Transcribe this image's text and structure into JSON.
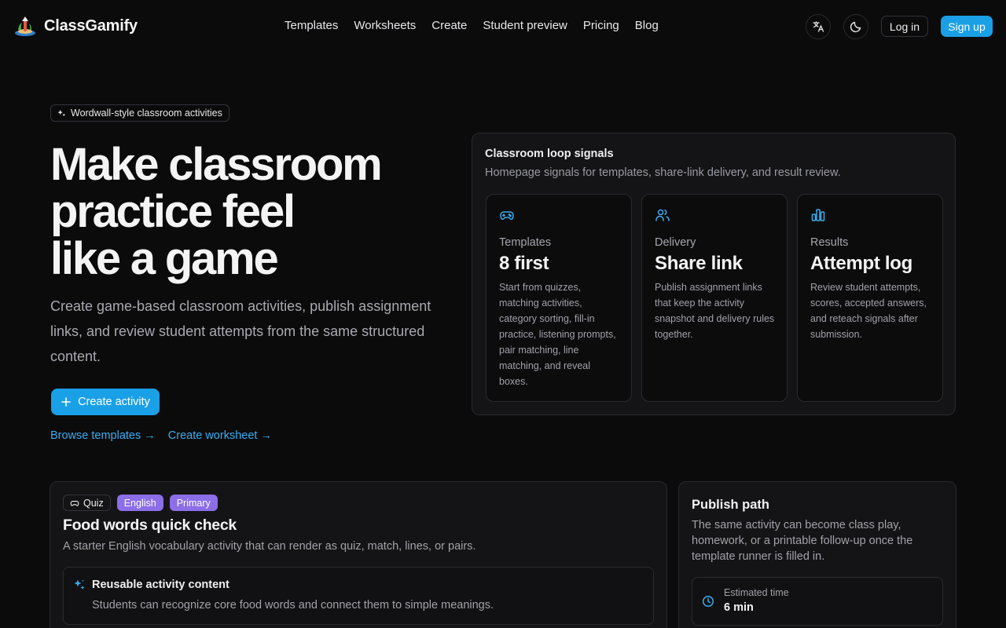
{
  "header": {
    "brand": "ClassGamify",
    "nav": [
      "Templates",
      "Worksheets",
      "Create",
      "Student preview",
      "Pricing",
      "Blog"
    ],
    "login": "Log in",
    "signup": "Sign up"
  },
  "hero": {
    "badge": "Wordwall-style classroom activities",
    "title_lines": [
      "Make classroom",
      "practice feel",
      "like a game"
    ],
    "subtitle": "Create game-based classroom activities, publish assignment links, and review student attempts from the same structured content.",
    "create_button": "Create activity",
    "browse_link": "Browse templates →",
    "worksheet_link": "Create worksheet →"
  },
  "signals": {
    "title": "Classroom loop signals",
    "subtitle": "Homepage signals for templates, share-link delivery, and result review.",
    "cards": [
      {
        "icon": "gamepad-icon",
        "label": "Templates",
        "value": "8 first",
        "desc": "Start from quizzes, matching activities, category sorting, fill-in practice, listening prompts, pair matching, line matching, and reveal boxes."
      },
      {
        "icon": "users-icon",
        "label": "Delivery",
        "value": "Share link",
        "desc": "Publish assignment links that keep the activity snapshot and delivery rules together."
      },
      {
        "icon": "bar-chart-icon",
        "label": "Results",
        "value": "Attempt log",
        "desc": "Review student attempts, scores, accepted answers, and reteach signals after submission."
      }
    ]
  },
  "activity": {
    "tags": {
      "quiz": "Quiz",
      "subject": "English",
      "level": "Primary"
    },
    "title": "Food words quick check",
    "desc": "A starter English vocabulary activity that can render as quiz, match, lines, or pairs.",
    "reuse_title": "Reusable activity content",
    "reuse_desc": "Students can recognize core food words and connect them to simple meanings."
  },
  "publish": {
    "title": "Publish path",
    "desc": "The same activity can become class play, homework, or a printable follow-up once the template runner is filled in.",
    "est_label": "Estimated time",
    "est_value": "6 min"
  },
  "colors": {
    "accent": "#1aa0e6",
    "purple": "#8b6ee8",
    "link": "#3aaef0"
  }
}
